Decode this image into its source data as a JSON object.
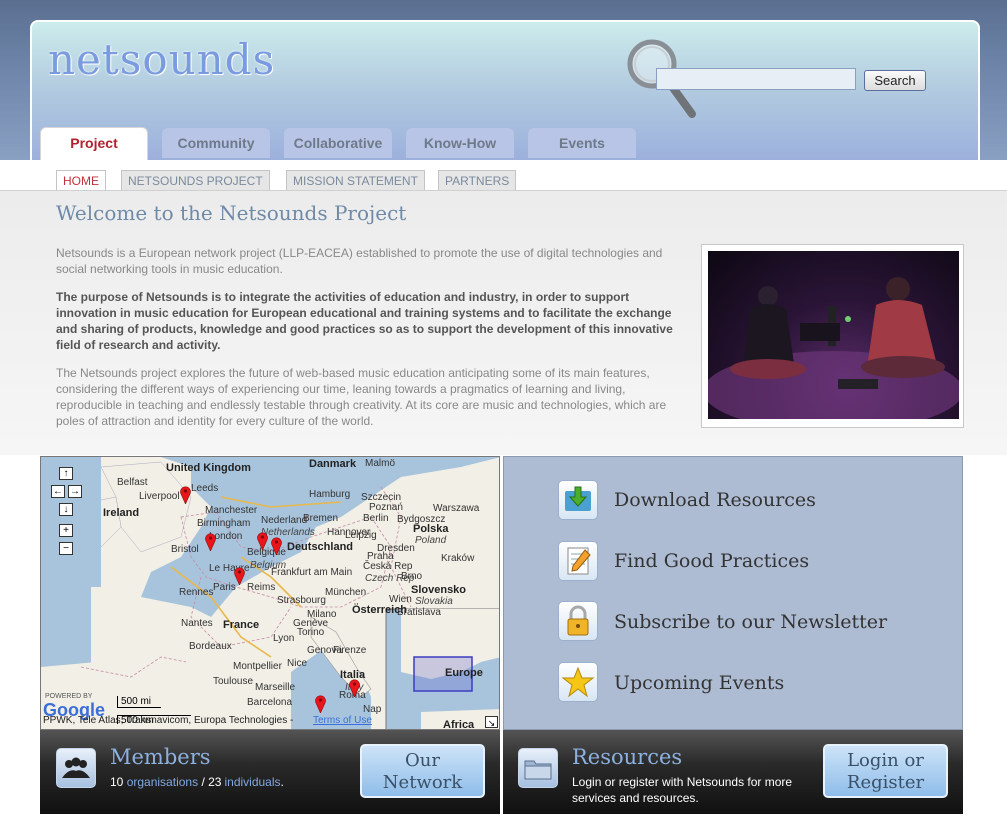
{
  "header": {
    "logo_text": "netsounds",
    "search_button": "Search",
    "search_value": ""
  },
  "tabs": [
    {
      "label": "Project",
      "active": true
    },
    {
      "label": "Community",
      "active": false
    },
    {
      "label": "Collaborative",
      "active": false
    },
    {
      "label": "Know-How",
      "active": false
    },
    {
      "label": "Events",
      "active": false
    }
  ],
  "subnav": [
    {
      "label": "HOME",
      "active": true
    },
    {
      "label": "NETSOUNDS PROJECT",
      "active": false
    },
    {
      "label": "MISSION STATEMENT",
      "active": false
    },
    {
      "label": "PARTNERS",
      "active": false
    }
  ],
  "main": {
    "title": "Welcome to the Netsounds Project",
    "para1": "Netsounds is a European network project (LLP-EACEA) established to promote the use of digital technologies and social networking tools in music education.",
    "para2": "The purpose of Netsounds is to integrate the activities of education and industry, in order to support innovation in music education for European educational and training systems and to facilitate the exchange and sharing of products, knowledge and good practices so as to support the development of this innovative field of research and activity.",
    "para3": "The Netsounds project explores the future of web-based music education anticipating some of its main features, considering the different ways of experiencing our time, leaning towards a pragmatics of learning and living, reproducible in teaching and endlessly testable through creativity. At its core are music and technologies, which are poles of attraction and identity for every culture of the world."
  },
  "map": {
    "labels": {
      "united_kingdom": "United Kingdom",
      "ireland": "Ireland",
      "france": "France",
      "deutschland": "Deutschland",
      "nederland": "Nederland",
      "netherlands": "Netherlands",
      "belgique": "Belgique",
      "belgium": "Belgium",
      "polska": "Polska",
      "poland": "Poland",
      "ceska": "Česká Rep",
      "czech": "Czech Rep",
      "slovensko": "Slovensko",
      "slovakia": "Slovakia",
      "osterreich": "Österreich",
      "italia": "Italia",
      "italy": "Italy",
      "denmark": "Danmark",
      "europe": "Europe",
      "africa": "Africa",
      "belfast": "Belfast",
      "liverpool": "Liverpool",
      "leeds": "Leeds",
      "manchester": "Manchester",
      "birmingham": "Birmingham",
      "london": "London",
      "bristol": "Bristol",
      "le_havre": "Le Havre",
      "paris": "Paris",
      "reims": "Reims",
      "rennes": "Rennes",
      "nantes": "Nantes",
      "bordeaux": "Bordeaux",
      "toulouse": "Toulouse",
      "montpellier": "Montpellier",
      "marseille": "Marseille",
      "nice": "Nice",
      "barcelona": "Barcelona",
      "lyon": "Lyon",
      "geneve": "Genève",
      "strasbourg": "Strasbourg",
      "frankfurt": "Frankfurt am Main",
      "hamburg": "Hamburg",
      "hannover": "Hannover",
      "berlin": "Berlin",
      "leipzig": "Leipzig",
      "dresden": "Dresden",
      "munchen": "München",
      "wien": "Wien",
      "praha": "Praha",
      "krakow": "Kraków",
      "warszawa": "Warszawa",
      "bydgoszcz": "Bydgoszcz",
      "szczecin": "Szczecin",
      "poznan": "Poznań",
      "malmo": "Malmö",
      "milano": "Milano",
      "torino": "Torino",
      "firenze": "Firenze",
      "genova": "Genova",
      "roma": "Roma",
      "napoli": "Nap",
      "bremen": "Bremen",
      "brno": "Brno",
      "bratislava": "Bratislava"
    },
    "scale_mi": "500 mi",
    "scale_km": "500 km",
    "powered_by": "POWERED BY",
    "google": "Google",
    "attribution": "PPWK, Tele Atlas, Transnavicom, Europa Technologies -",
    "terms": "Terms of Use",
    "controls": {
      "up": "↑",
      "left": "←",
      "right": "→",
      "down": "↓",
      "zoom_in": "+",
      "zoom_out": "−"
    }
  },
  "resources": [
    {
      "label": "Download Resources",
      "icon": "download-icon"
    },
    {
      "label": "Find Good Practices",
      "icon": "notepad-pencil-icon"
    },
    {
      "label": "Subscribe to our Newsletter",
      "icon": "padlock-icon"
    },
    {
      "label": "Upcoming Events",
      "icon": "star-icon"
    }
  ],
  "members": {
    "title": "Members",
    "org_count": "10",
    "org_label": "organisations",
    "separator": "/",
    "ind_count": "23",
    "ind_label": "individuals",
    "period": ".",
    "button_line1": "Our",
    "button_line2": "Network"
  },
  "resources_bar": {
    "title": "Resources",
    "text_line1": "Login or register with Netsounds for more",
    "text_line2": "services and resources.",
    "button_line1": "Login or",
    "button_line2": "Register"
  },
  "colors": {
    "accent_red": "#b3202c",
    "link_blue": "#82a8e0",
    "title_blue": "#6f8aa8"
  }
}
